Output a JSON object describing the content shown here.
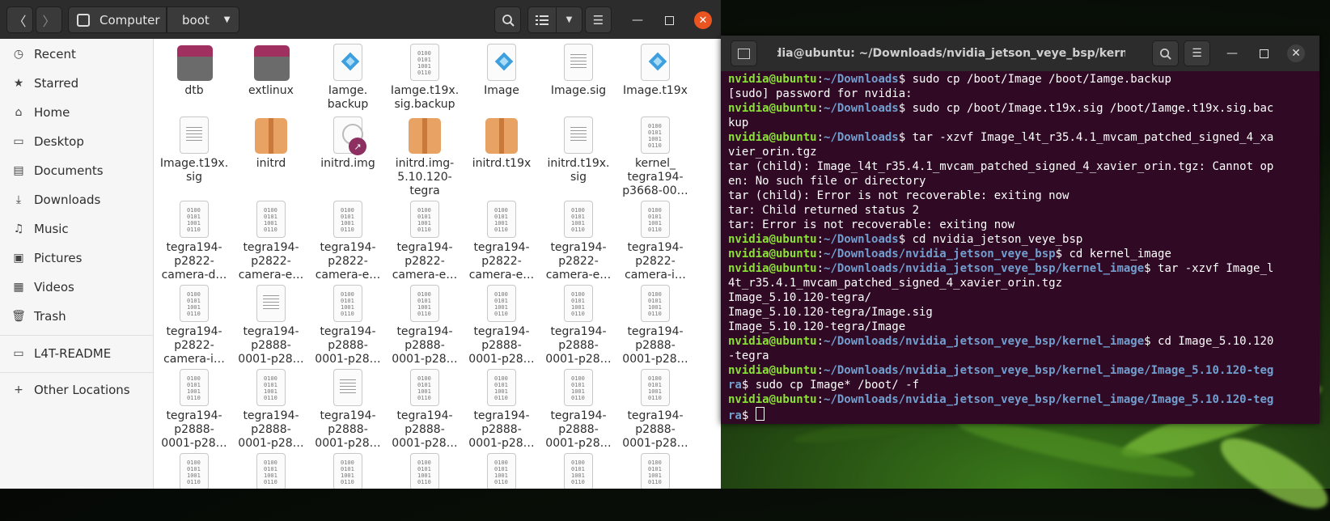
{
  "files": {
    "path": {
      "root_label": "Computer",
      "current": "boot"
    },
    "sidebar": [
      {
        "label": "Recent",
        "icon": "clock-icon"
      },
      {
        "label": "Starred",
        "icon": "star-icon"
      },
      {
        "label": "Home",
        "icon": "home-icon"
      },
      {
        "label": "Desktop",
        "icon": "desktop-icon"
      },
      {
        "label": "Documents",
        "icon": "documents-icon"
      },
      {
        "label": "Downloads",
        "icon": "download-icon"
      },
      {
        "label": "Music",
        "icon": "music-icon"
      },
      {
        "label": "Pictures",
        "icon": "pictures-icon"
      },
      {
        "label": "Videos",
        "icon": "videos-icon"
      },
      {
        "label": "Trash",
        "icon": "trash-icon"
      },
      {
        "label": "L4T-README",
        "icon": "drive-icon"
      },
      {
        "label": "Other Locations",
        "icon": "plus-icon"
      }
    ],
    "items": [
      {
        "name": "dtb",
        "type": "folder"
      },
      {
        "name": "extlinux",
        "type": "folder"
      },
      {
        "name": "Iamge.\nbackup",
        "type": "image"
      },
      {
        "name": "Iamge.t19x.\nsig.backup",
        "type": "binary"
      },
      {
        "name": "Image",
        "type": "image"
      },
      {
        "name": "Image.sig",
        "type": "text"
      },
      {
        "name": "Image.t19x",
        "type": "image"
      },
      {
        "name": "Image.t19x.\nsig",
        "type": "text"
      },
      {
        "name": "initrd",
        "type": "archive"
      },
      {
        "name": "initrd.img",
        "type": "link"
      },
      {
        "name": "initrd.img-\n5.10.120-\ntegra",
        "type": "archive"
      },
      {
        "name": "initrd.t19x",
        "type": "archive"
      },
      {
        "name": "initrd.t19x.\nsig",
        "type": "text"
      },
      {
        "name": "kernel_\ntegra194-\np3668-00…",
        "type": "binary"
      },
      {
        "name": "tegra194-\np2822-\ncamera-d…",
        "type": "binary"
      },
      {
        "name": "tegra194-\np2822-\ncamera-e…",
        "type": "binary"
      },
      {
        "name": "tegra194-\np2822-\ncamera-e…",
        "type": "binary"
      },
      {
        "name": "tegra194-\np2822-\ncamera-e…",
        "type": "binary"
      },
      {
        "name": "tegra194-\np2822-\ncamera-e…",
        "type": "binary"
      },
      {
        "name": "tegra194-\np2822-\ncamera-e…",
        "type": "binary"
      },
      {
        "name": "tegra194-\np2822-\ncamera-i…",
        "type": "binary"
      },
      {
        "name": "tegra194-\np2822-\ncamera-i…",
        "type": "binary"
      },
      {
        "name": "tegra194-\np2888-\n0001-p28…",
        "type": "text"
      },
      {
        "name": "tegra194-\np2888-\n0001-p28…",
        "type": "binary"
      },
      {
        "name": "tegra194-\np2888-\n0001-p28…",
        "type": "binary"
      },
      {
        "name": "tegra194-\np2888-\n0001-p28…",
        "type": "binary"
      },
      {
        "name": "tegra194-\np2888-\n0001-p28…",
        "type": "binary"
      },
      {
        "name": "tegra194-\np2888-\n0001-p28…",
        "type": "binary"
      },
      {
        "name": "tegra194-\np2888-\n0001-p28…",
        "type": "binary"
      },
      {
        "name": "tegra194-\np2888-\n0001-p28…",
        "type": "binary"
      },
      {
        "name": "tegra194-\np2888-\n0001-p28…",
        "type": "text"
      },
      {
        "name": "tegra194-\np2888-\n0001-p28…",
        "type": "binary"
      },
      {
        "name": "tegra194-\np2888-\n0001-p28…",
        "type": "binary"
      },
      {
        "name": "tegra194-\np2888-\n0001-p28…",
        "type": "binary"
      },
      {
        "name": "tegra194-\np2888-\n0001-p28…",
        "type": "binary"
      }
    ]
  },
  "terminal": {
    "title": "nvidia@ubuntu: ~/Downloads/nvidia_jetson_veye_bsp/kerne...",
    "lines": [
      {
        "u": "nvidia@ubuntu",
        "p": "~/Downloads",
        "t": "$ sudo cp /boot/Image /boot/Iamge.backup"
      },
      {
        "t": "[sudo] password for nvidia:"
      },
      {
        "u": "nvidia@ubuntu",
        "p": "~/Downloads",
        "t": "$ sudo cp /boot/Image.t19x.sig /boot/Iamge.t19x.sig.bac"
      },
      {
        "t": "kup"
      },
      {
        "u": "nvidia@ubuntu",
        "p": "~/Downloads",
        "t": "$ tar -xzvf Image_l4t_r35.4.1_mvcam_patched_signed_4_xa"
      },
      {
        "t": "vier_orin.tgz"
      },
      {
        "t": "tar (child): Image_l4t_r35.4.1_mvcam_patched_signed_4_xavier_orin.tgz: Cannot op"
      },
      {
        "t": "en: No such file or directory"
      },
      {
        "t": "tar (child): Error is not recoverable: exiting now"
      },
      {
        "t": "tar: Child returned status 2"
      },
      {
        "t": "tar: Error is not recoverable: exiting now"
      },
      {
        "u": "nvidia@ubuntu",
        "p": "~/Downloads",
        "t": "$ cd nvidia_jetson_veye_bsp"
      },
      {
        "u": "nvidia@ubuntu",
        "p": "~/Downloads/nvidia_jetson_veye_bsp",
        "t": "$ cd kernel_image"
      },
      {
        "u": "nvidia@ubuntu",
        "p": "~/Downloads/nvidia_jetson_veye_bsp/kernel_image",
        "t": "$ tar -xzvf Image_l"
      },
      {
        "t": "4t_r35.4.1_mvcam_patched_signed_4_xavier_orin.tgz"
      },
      {
        "t": "Image_5.10.120-tegra/"
      },
      {
        "t": "Image_5.10.120-tegra/Image.sig"
      },
      {
        "t": "Image_5.10.120-tegra/Image"
      },
      {
        "u": "nvidia@ubuntu",
        "p": "~/Downloads/nvidia_jetson_veye_bsp/kernel_image",
        "t": "$ cd Image_5.10.120"
      },
      {
        "t": "-tegra"
      },
      {
        "u": "nvidia@ubuntu",
        "p": "~/Downloads/nvidia_jetson_veye_bsp/kernel_image/Image_5.10.120-teg",
        "t": ""
      },
      {
        "p": "ra",
        "t": "$ sudo cp Image* /boot/ -f"
      },
      {
        "u": "nvidia@ubuntu",
        "p": "~/Downloads/nvidia_jetson_veye_bsp/kernel_image/Image_5.10.120-teg",
        "t": ""
      },
      {
        "p": "ra",
        "t": "$ ",
        "cursor": true
      }
    ]
  }
}
